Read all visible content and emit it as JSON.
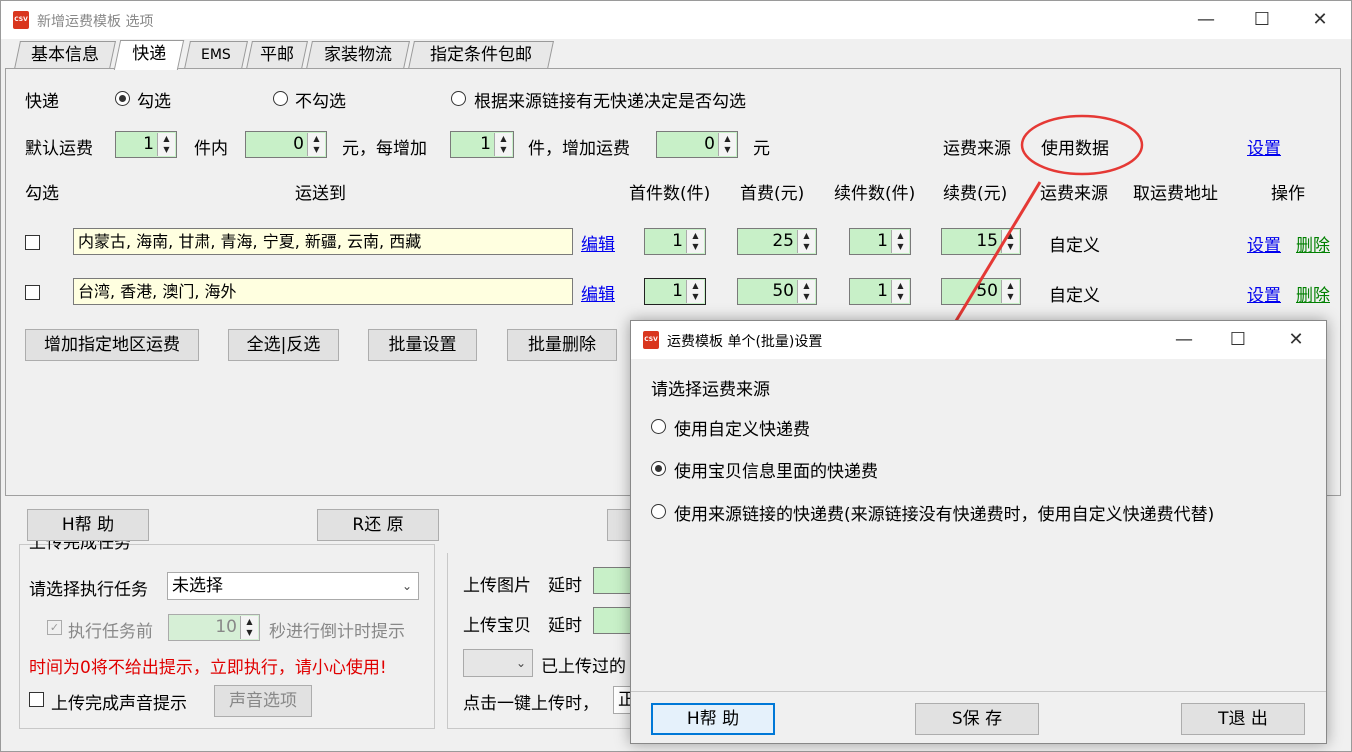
{
  "window": {
    "title": "新增运费模板 选项",
    "icon_text": "CSV",
    "controls": {
      "minimize": "—",
      "maximize": "☐",
      "close": "✕"
    }
  },
  "tabs": [
    "基本信息",
    "快递",
    "EMS",
    "平邮",
    "家装物流",
    "指定条件包邮"
  ],
  "active_tab": "快递",
  "express": {
    "label": "快递",
    "options": [
      "勾选",
      "不勾选",
      "根据来源链接有无快递决定是否勾选"
    ],
    "selected": "勾选"
  },
  "default_fee": {
    "label": "默认运费",
    "qty": "1",
    "unit1": "件内",
    "fee": "0",
    "text_mid": "元，每增加",
    "add_qty": "1",
    "text_add": "件，增加运费",
    "add_fee": "0",
    "unit2": "元",
    "source_label": "运费来源",
    "source_value": "使用数据",
    "settings_link": "设置"
  },
  "table": {
    "headers": [
      "勾选",
      "运送到",
      "首件数(件)",
      "首费(元)",
      "续件数(件)",
      "续费(元)",
      "运费来源",
      "取运费地址",
      "操作"
    ],
    "rows": [
      {
        "regions": "内蒙古, 海南, 甘肃, 青海, 宁夏, 新疆, 云南, 西藏",
        "edit": "编辑",
        "first_qty": "1",
        "first_fee": "25",
        "next_qty": "1",
        "next_fee": "15",
        "source": "自定义",
        "set": "设置",
        "del": "删除"
      },
      {
        "regions": "台湾, 香港, 澳门, 海外",
        "edit": "编辑",
        "first_qty": "1",
        "first_fee": "50",
        "next_qty": "1",
        "next_fee": "50",
        "source": "自定义",
        "set": "设置",
        "del": "删除"
      }
    ]
  },
  "actions": [
    "增加指定地区运费",
    "全选|反选",
    "批量设置",
    "批量删除"
  ],
  "bottom_buttons": {
    "help": "H帮  助",
    "restore": "R还  原"
  },
  "background": {
    "group_title": "上传完成任务",
    "task_label": "请选择执行任务",
    "task_value": "未选择",
    "before_label": "执行任务前",
    "before_value": "10",
    "before_suffix": "秒进行倒计时提示",
    "warning": "时间为0将不给出提示，立即执行，请小心使用!",
    "sound_label": "上传完成声音提示",
    "sound_button": "声音选项",
    "upload_img": "上传图片",
    "upload_item": "上传宝贝",
    "delay": "延时",
    "uploaded_text": "已上传过的",
    "click_text": "点击一键上传时，",
    "click_value": "正"
  },
  "dialog": {
    "title": "运费模板 单个(批量)设置",
    "icon_text": "CSV",
    "prompt": "请选择运费来源",
    "options": [
      "使用自定义快递费",
      "使用宝贝信息里面的快递费",
      "使用来源链接的快递费(来源链接没有快递费时，使用自定义快递费代替)"
    ],
    "selected": "使用宝贝信息里面的快递费",
    "buttons": {
      "help": "H帮  助",
      "save": "S保  存",
      "exit": "T退  出"
    }
  },
  "annotation": {
    "color": "#e53935"
  }
}
